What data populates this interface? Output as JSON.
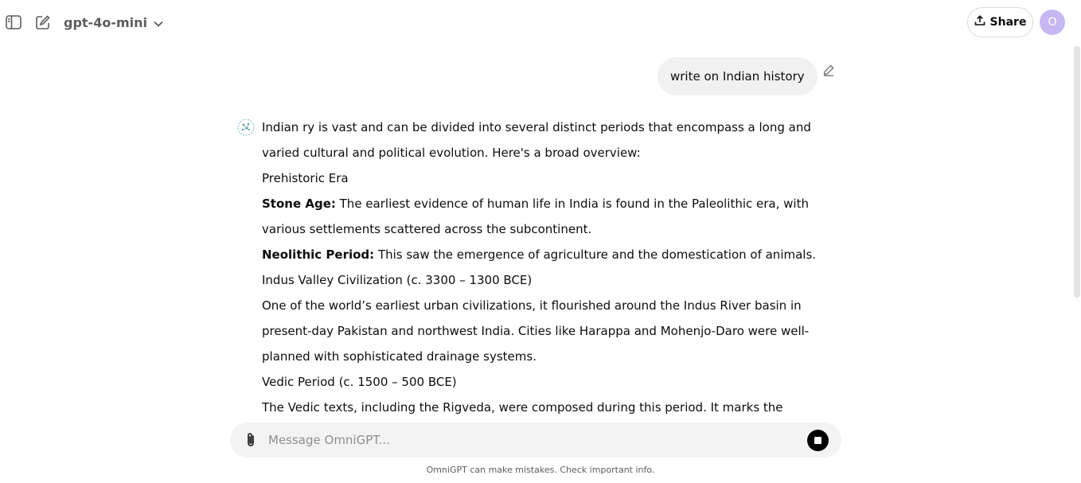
{
  "header": {
    "model_name": "gpt-4o-mini",
    "share_label": "Share",
    "avatar_initial": "O"
  },
  "conversation": {
    "user_message": "write on Indian history",
    "assistant": {
      "intro": "Indian ry is vast and can be divided into several distinct periods that encompass a long and varied cultural and political evolution. Here's a broad overview:",
      "heading_prehistoric": "Prehistoric Era",
      "stone_age_label": "Stone Age:",
      "stone_age_text": " The earliest evidence of human life in India is found in the Paleolithic era, with various settlements scattered across the subcontinent.",
      "neolithic_label": "Neolithic Period:",
      "neolithic_text": " This saw the emergence of agriculture and the domestication of animals.",
      "heading_indus": "Indus Valley Civilization (c. 3300 – 1300 BCE)",
      "indus_text": "One of the world’s earliest urban civilizations, it flourished around the Indus River basin in present-day Pakistan and northwest India. Cities like Harappa and Mohenjo-Daro were well-planned with sophisticated drainage systems.",
      "heading_vedic": "Vedic Period (c. 1500 – 500 BCE)",
      "vedic_text": "The Vedic texts, including the Rigveda, were composed during this period. It marks the transition"
    }
  },
  "composer": {
    "placeholder": "Message OmniGPT..."
  },
  "footer": {
    "note": "OmniGPT can make mistakes. Check important info."
  },
  "colors": {
    "avatar_bg": "#c6b7f3",
    "user_bubble_bg": "#f1f1f1",
    "composer_bg": "#f3f3f3",
    "stop_button": "#000000"
  }
}
